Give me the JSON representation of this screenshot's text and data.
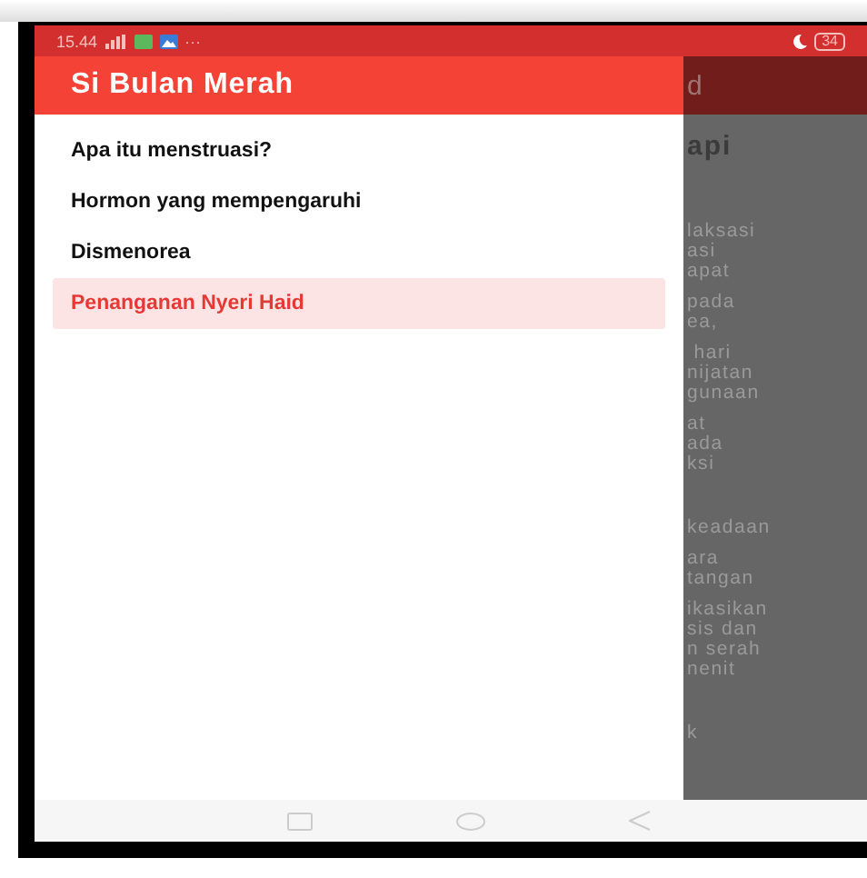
{
  "status_bar": {
    "time": "15.44",
    "more": "···",
    "battery": "34"
  },
  "drawer": {
    "title": "Si Bulan Merah",
    "items": [
      {
        "label": "Apa itu menstruasi?",
        "selected": false
      },
      {
        "label": "Hormon yang mempengaruhi",
        "selected": false
      },
      {
        "label": "Dismenorea",
        "selected": false
      },
      {
        "label": "Penanganan Nyeri Haid",
        "selected": true
      }
    ]
  },
  "background_page": {
    "title": "d",
    "heading": "api",
    "paragraphs": [
      "laksasi\nasi\napat",
      "pada\nea,",
      " hari\nnijatan\ngunaan",
      "at\nada\nksi",
      "keadaan",
      "ara\ntangan",
      "ikasikan\nsis dan\nn serah\nnenit",
      "k"
    ]
  }
}
